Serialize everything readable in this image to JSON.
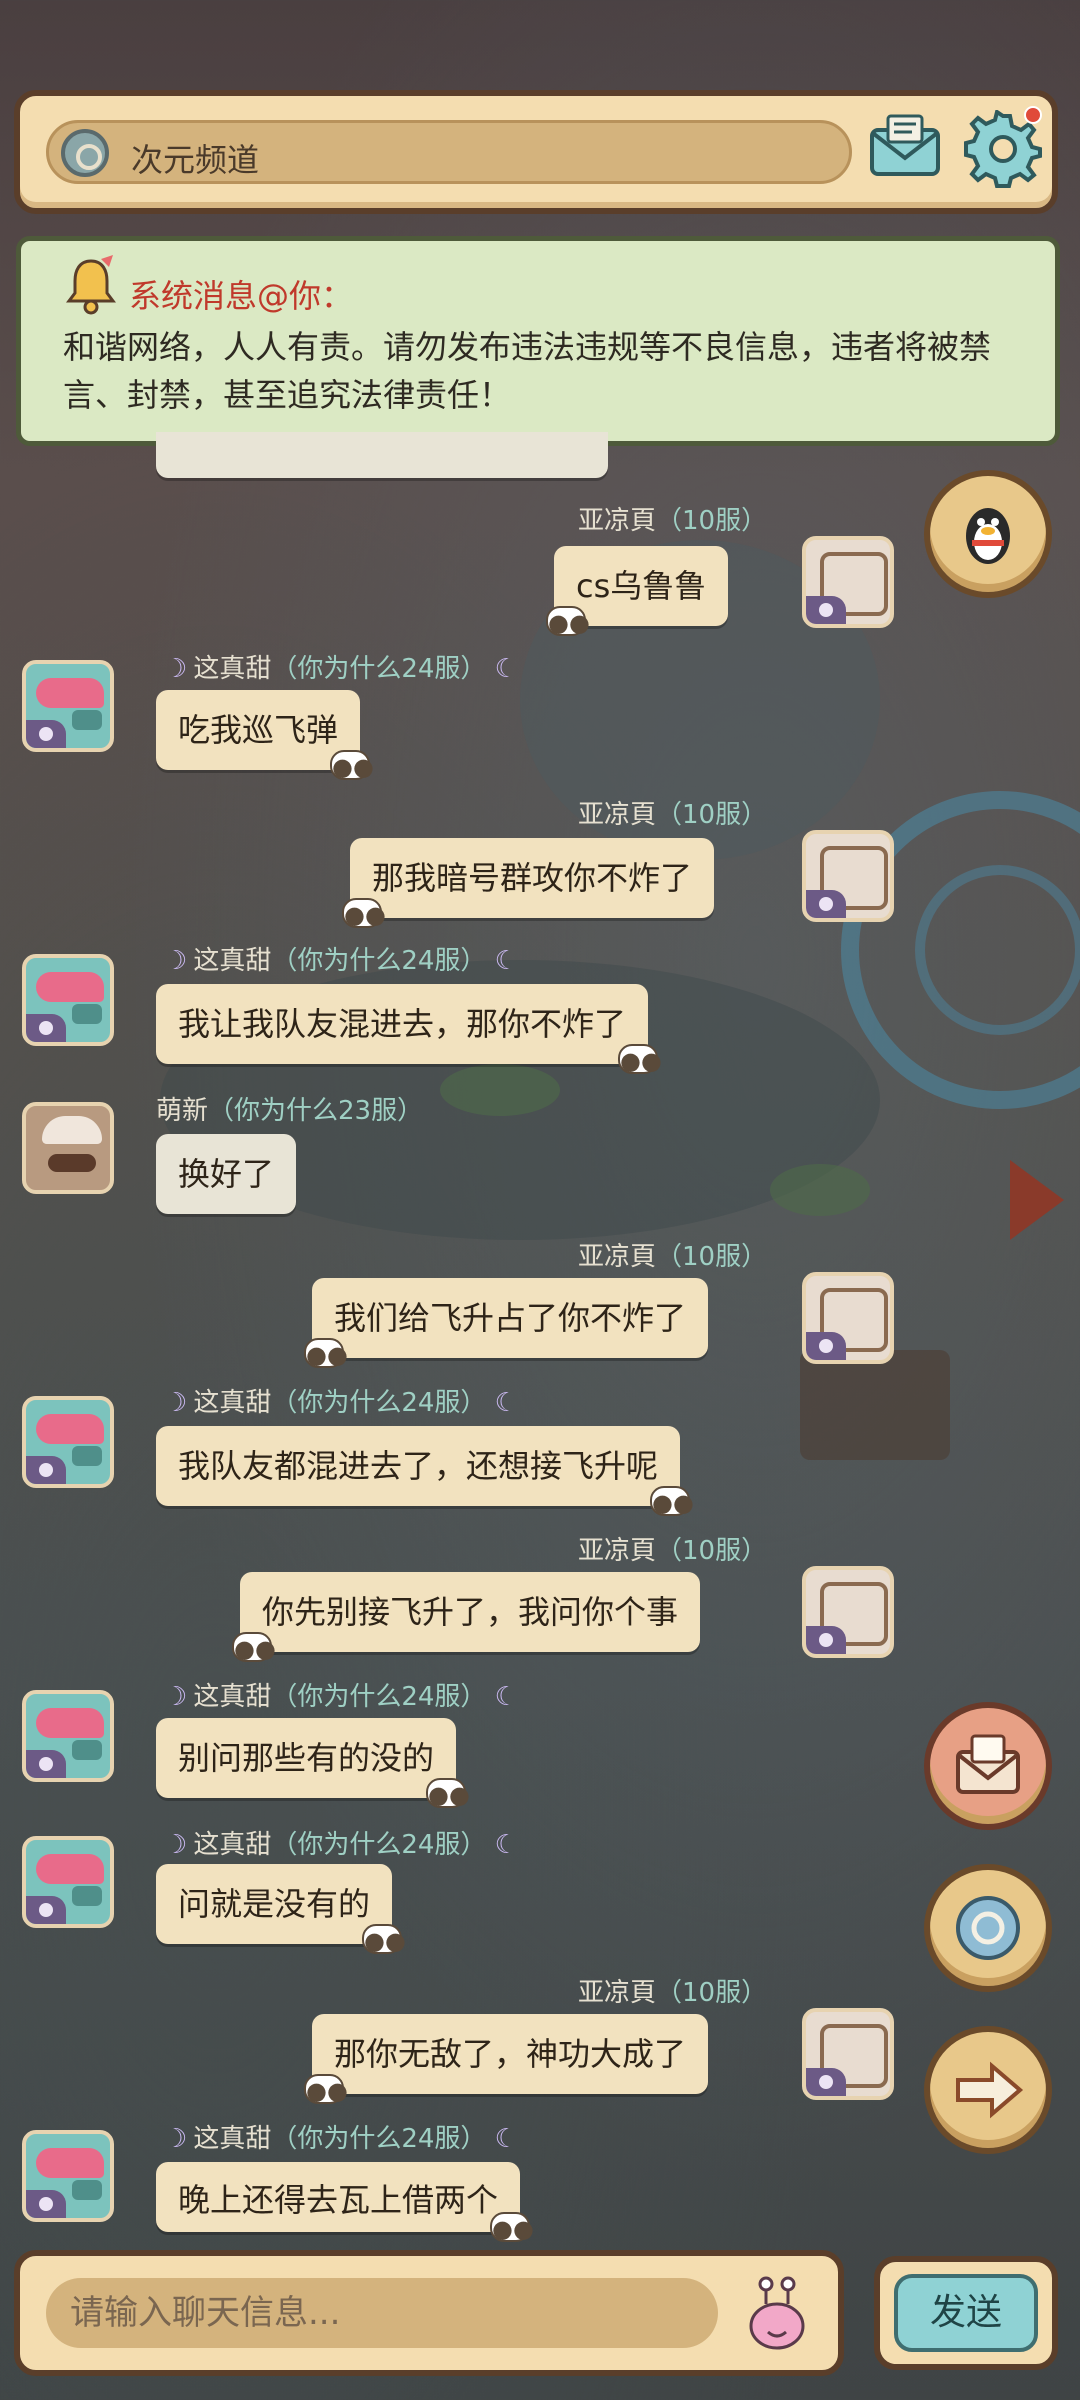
{
  "header": {
    "channel_name": "次元频道",
    "channel_icon": "portal-icon",
    "mail_icon": "mail-icon",
    "settings_icon": "gear-icon",
    "has_notification": true
  },
  "notice": {
    "title": "系统消息@你：",
    "body": "和谐网络，人人有责。请勿发布违法违规等不良信息，违者将被禁言、封禁，甚至追究法律责任！"
  },
  "messages": [
    {
      "side": "right",
      "user": "亚凉頁",
      "server": "（10服）",
      "text": "cs乌鲁鲁"
    },
    {
      "side": "left",
      "user": "这真甜",
      "server": "（你为什么24服）",
      "text": "吃我巡飞弹"
    },
    {
      "side": "right",
      "user": "亚凉頁",
      "server": "（10服）",
      "text": "那我暗号群攻你不炸了"
    },
    {
      "side": "left",
      "user": "这真甜",
      "server": "（你为什么24服）",
      "text": "我让我队友混进去，那你不炸了"
    },
    {
      "side": "left",
      "user": "萌新",
      "server": "（你为什么23服）",
      "text": "换好了"
    },
    {
      "side": "right",
      "user": "亚凉頁",
      "server": "（10服）",
      "text": "我们给飞升占了你不炸了"
    },
    {
      "side": "left",
      "user": "这真甜",
      "server": "（你为什么24服）",
      "text": "我队友都混进去了，还想接飞升呢"
    },
    {
      "side": "right",
      "user": "亚凉頁",
      "server": "（10服）",
      "text": "你先别接飞升了，我问你个事"
    },
    {
      "side": "left",
      "user": "这真甜",
      "server": "（你为什么24服）",
      "text": "别问那些有的没的"
    },
    {
      "side": "left",
      "user": "这真甜",
      "server": "（你为什么24服）",
      "text": "问就是没有的"
    },
    {
      "side": "right",
      "user": "亚凉頁",
      "server": "（10服）",
      "text": "那你无敌了，神功大成了"
    },
    {
      "side": "left",
      "user": "这真甜",
      "server": "（你为什么24服）",
      "text": "晚上还得去瓦上借两个"
    }
  ],
  "side_buttons": [
    "qq-penguin-icon",
    "mail-icon",
    "portal-icon",
    "arrow-right-icon"
  ],
  "input": {
    "placeholder": "请输入聊天信息...",
    "emoji_icon": "snail-emoji-icon"
  },
  "send_label": "发送"
}
